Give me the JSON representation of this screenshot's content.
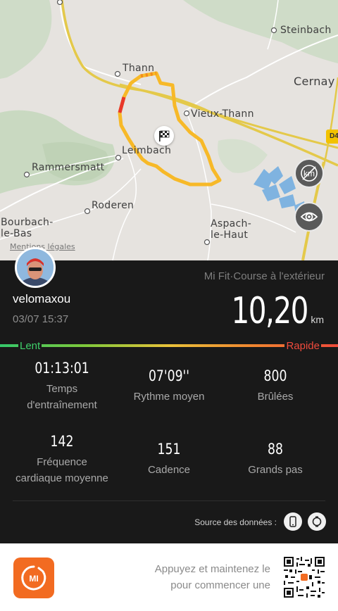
{
  "map": {
    "places": [
      {
        "key": "steinbach",
        "label": "Steinbach"
      },
      {
        "key": "cernay",
        "label": "Cernay"
      },
      {
        "key": "thann",
        "label": "Thann"
      },
      {
        "key": "vieux_thann",
        "label": "Vieux-Thann"
      },
      {
        "key": "leimbach",
        "label": "Leimbach"
      },
      {
        "key": "rammersmatt",
        "label": "Rammersmatt"
      },
      {
        "key": "roderen",
        "label": "Roderen"
      },
      {
        "key": "bourbach",
        "label": "Bourbach-\nle-Bas"
      },
      {
        "key": "aspach",
        "label": "Aspach-\nle-Haut"
      }
    ],
    "road_badge": "D4",
    "legal_link": "Mentions légales",
    "buttons": {
      "km_markers": "km-markers-off-icon",
      "visibility": "eye-icon"
    },
    "route_color": "#f7b928"
  },
  "workout": {
    "username": "velomaxou",
    "datetime": "03/07 15:37",
    "source_app": "Mi Fit·Course à l'extérieur",
    "distance": "10,20",
    "distance_unit": "km",
    "speed_legend": {
      "slow": "Lent",
      "fast": "Rapide"
    },
    "stats": [
      {
        "value": "01:13:01",
        "label": "Temps\nd'entraînement"
      },
      {
        "value": "07'09''",
        "label": "Rythme moyen"
      },
      {
        "value": "800",
        "label": "Brûlées"
      },
      {
        "value": "142",
        "label": "Fréquence\ncardiaque moyenne"
      },
      {
        "value": "151",
        "label": "Cadence"
      },
      {
        "value": "88",
        "label": "Grands pas"
      }
    ],
    "data_source_label": "Source des données :",
    "data_source_icons": [
      "phone-icon",
      "watch-icon"
    ]
  },
  "banner": {
    "text": "Appuyez et maintenez le\npour commencer une",
    "logo": "mi-logo-icon",
    "qr": "qr-code-icon"
  },
  "colors": {
    "panel_bg": "#191919",
    "slow": "#3fcf6a",
    "fast": "#ef4a3c",
    "brand": "#f26b21"
  }
}
